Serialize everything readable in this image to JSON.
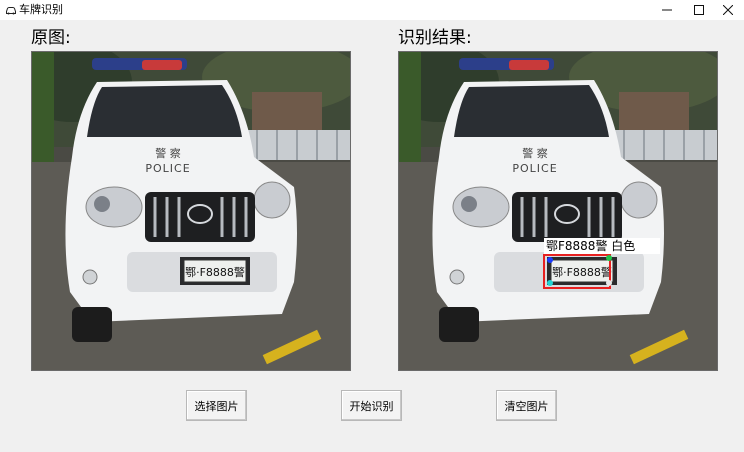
{
  "window": {
    "title": "车牌识别",
    "icon": "car-icon",
    "controls": [
      "minimize-icon",
      "maximize-icon",
      "close-icon"
    ]
  },
  "panels": {
    "original_label": "原图:",
    "result_label": "识别结果:"
  },
  "scene": {
    "police_text": "POLICE",
    "police_chars": "警 察",
    "plate_text": "鄂·F8888警"
  },
  "result": {
    "detection_label": "鄂F8888警 白色",
    "plate_color_box": "#e82020",
    "plate_label_bg": "#ffffff"
  },
  "buttons": {
    "select_image": "选择图片",
    "start_recognize": "开始识别",
    "clear_image": "清空图片"
  }
}
